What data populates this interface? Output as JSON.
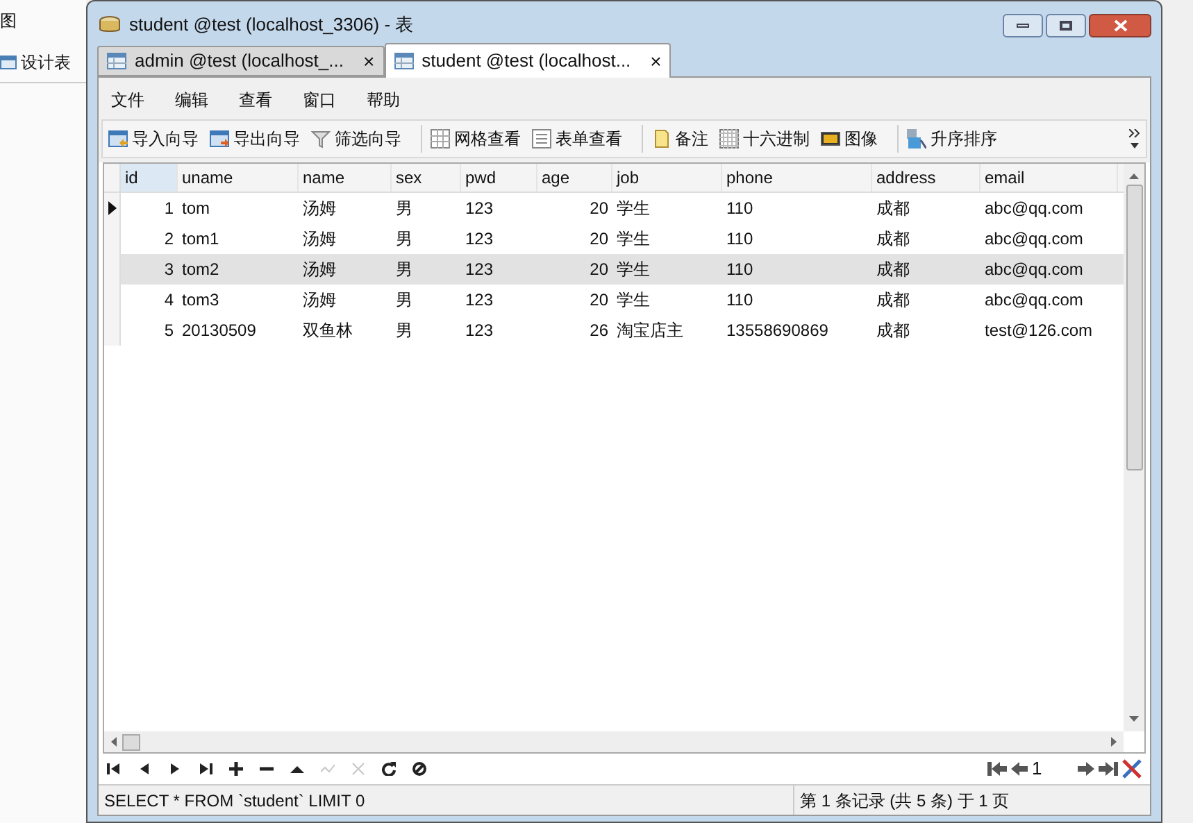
{
  "background_window": {
    "menu_fragment": "图",
    "toolbar_button": "设计表"
  },
  "window": {
    "title": "student @test (localhost_3306) - 表"
  },
  "tabs": [
    {
      "label": "admin @test (localhost_...",
      "close": "×",
      "selected": false
    },
    {
      "label": "student @test (localhost...",
      "close": "×",
      "selected": true
    }
  ],
  "menu": [
    "文件",
    "编辑",
    "查看",
    "窗口",
    "帮助"
  ],
  "toolbar": [
    "导入向导",
    "导出向导",
    "筛选向导",
    "网格查看",
    "表单查看",
    "备注",
    "十六进制",
    "图像",
    "升序排序"
  ],
  "table": {
    "columns": [
      "id",
      "uname",
      "name",
      "sex",
      "pwd",
      "age",
      "job",
      "phone",
      "address",
      "email"
    ],
    "rows": [
      {
        "cells": [
          "1",
          "tom",
          "汤姆",
          "男",
          "123",
          "20",
          "学生",
          "110",
          "成都",
          "abc@qq.com"
        ],
        "selected": true,
        "highlighted": false
      },
      {
        "cells": [
          "2",
          "tom1",
          "汤姆",
          "男",
          "123",
          "20",
          "学生",
          "110",
          "成都",
          "abc@qq.com"
        ],
        "selected": false,
        "highlighted": false
      },
      {
        "cells": [
          "3",
          "tom2",
          "汤姆",
          "男",
          "123",
          "20",
          "学生",
          "110",
          "成都",
          "abc@qq.com"
        ],
        "selected": false,
        "highlighted": true
      },
      {
        "cells": [
          "4",
          "tom3",
          "汤姆",
          "男",
          "123",
          "20",
          "学生",
          "110",
          "成都",
          "abc@qq.com"
        ],
        "selected": false,
        "highlighted": false
      },
      {
        "cells": [
          "5",
          "20130509",
          "双鱼林",
          "男",
          "123",
          "26",
          "淘宝店主",
          "13558690869",
          "成都",
          "test@126.com"
        ],
        "selected": false,
        "highlighted": false
      }
    ]
  },
  "record_nav": [
    {
      "disabled": false
    },
    {
      "disabled": false
    },
    {
      "disabled": false
    },
    {
      "disabled": false
    },
    {
      "disabled": false
    },
    {
      "disabled": false
    },
    {
      "disabled": false
    },
    {
      "disabled": true
    },
    {
      "disabled": true
    },
    {
      "disabled": false
    },
    {
      "disabled": false
    }
  ],
  "pager": {
    "page": "1"
  },
  "status_bar": {
    "query": "SELECT * FROM `student` LIMIT 0",
    "records": "第 1 条记录 (共 5 条) 于 1 页"
  }
}
